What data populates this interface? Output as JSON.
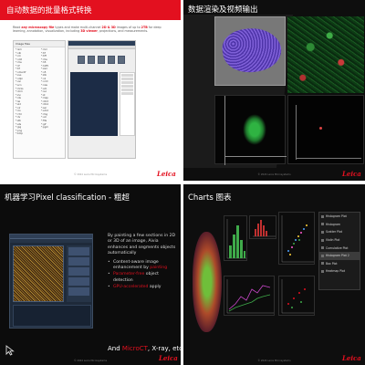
{
  "slides": {
    "batch": {
      "title": "自动数据的批量格式转换",
      "description_pre": "Read ",
      "description_highlight1": "any microscopy file",
      "description_mid1": " types and make multi-channel ",
      "description_highlight2": "2D & 3D",
      "description_mid2": " images of up to ",
      "description_highlight3": "2TB",
      "description_post": " for deep learning, annotation, visualization, including ",
      "description_highlight4": "3D viewer",
      "description_post2": ", projections, and measurements.",
      "explorer_title": "Image files",
      "files_left": [
        "*.lsm",
        "*.oib",
        "*.czi",
        "*.nd2",
        "*.ims",
        "*.lif",
        "*.tif",
        "*.ome.tif",
        "*.svs",
        "*.ndpi",
        "*.vsi",
        "*.scn",
        "*.mrxs",
        "*.dcm",
        "*.zvi",
        "*.ids",
        "*.lei",
        "*.sld",
        "*.oir",
        "*.ics",
        "*.r3d",
        "*.dv",
        "*.stk",
        "*.ets",
        "*.jpg",
        "*.png",
        "*.bmp"
      ],
      "files_right": [
        "*.mrc",
        "*.tif",
        "*.tiff",
        "*.ims",
        "*.h5",
        "*.hdf5",
        "*.zarr",
        "*.n5",
        "*.klb",
        "*.nii",
        "*.nrrd",
        "*.raw",
        "*.am",
        "*.rec",
        "*.st",
        "*.map",
        "*.dm3",
        "*.dm4",
        "*.ser",
        "*.emd",
        "*.img",
        "*.vol",
        "*.fits",
        "*.gif",
        "*.pgm"
      ],
      "footer": "© 2024 Leica Microsystems",
      "logo": "Leica"
    },
    "visualization": {
      "title": "数据渲染及视频输出",
      "footer": "© 2024 Leica Microsystems",
      "logo": "Leica"
    },
    "pixel_classification": {
      "title": "机器学习Pixel classification - 粗超",
      "intro": "By painting a few sections in 2D or 3D of an image, Aivia enhances and segments objects automatically",
      "bullets": [
        {
          "pre": "Content-aware image enhancement by ",
          "highlight": "painting",
          "post": ""
        },
        {
          "pre": "",
          "highlight": "Parameter-free",
          "post": " object detection"
        },
        {
          "pre": "",
          "highlight": "GPU-accelerated",
          "post": " apply"
        }
      ],
      "and_pre": "And ",
      "and_highlight": "MicroCT",
      "and_post": ", X-ray, etc..",
      "footer": "© 2024 Leica Microsystems",
      "logo": "Leica"
    },
    "charts": {
      "title": "Charts 图表",
      "menu_items": [
        "Histogram Plot",
        "Histogram",
        "Scatter Plot",
        "Violin Plot",
        "Cumulative Plot",
        "Histogram Plot 2",
        "Box Plot",
        "Heatmap Plot"
      ],
      "active_menu_index": 5,
      "footer": "© 2024 Leica Microsystems",
      "logo": "Leica"
    }
  },
  "colors": {
    "accent": "#e3101f",
    "dark_bg": "#0e0e0e"
  }
}
